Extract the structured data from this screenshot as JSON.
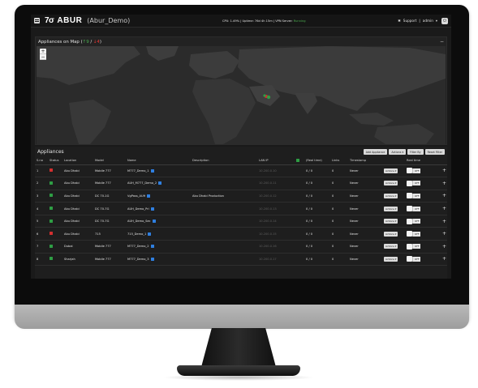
{
  "header": {
    "logo": "7σ",
    "brand": "ABUR",
    "project": "(Abur_Demo)",
    "cpu": "CPU: 1.49%",
    "uptime": "Uptime: 76d 4h 15m",
    "vpn_label": "VPN Server:",
    "vpn_status": "Running",
    "support": "Support",
    "user": "admin"
  },
  "map": {
    "title": "Appliances on Map (",
    "up_count": "9",
    "down_count": "4",
    "title_close": ")",
    "zoom_in": "+",
    "zoom_out": "−",
    "collapse": "−",
    "marker_colors": {
      "up": "#2e9e44",
      "down": "#d32f2f"
    }
  },
  "appliances": {
    "title": "Appliances",
    "buttons": [
      "Add Appliance",
      "Actions ▾",
      "Filter By",
      "Reset Filter"
    ],
    "columns": [
      "S.no",
      "Status",
      "Location",
      "Model",
      "Name",
      "Description",
      "LAN IP",
      "",
      "(Real time)",
      "Links",
      "Timestamp",
      "",
      "Real time",
      ""
    ],
    "rows": [
      {
        "sno": "1",
        "status": "down",
        "location": "Abu Dhabi",
        "model": "Mobile 777",
        "name": "M777_Demo_1",
        "description": "",
        "lan_ip": "10.200.0.10",
        "realtime": "0 / 0",
        "links": "0",
        "timestamp": "Never",
        "actions": "Actions ▾",
        "toggle": "OFF"
      },
      {
        "sno": "2",
        "status": "up",
        "location": "Abu Dhabi",
        "model": "Mobile 777",
        "name": "AUH_M777_Demo_2",
        "description": "",
        "lan_ip": "10.200.0.11",
        "realtime": "0 / 0",
        "links": "0",
        "timestamp": "Never",
        "actions": "Actions ▾",
        "toggle": "OFF"
      },
      {
        "sno": "3",
        "status": "up",
        "location": "Abu Dhabi",
        "model": "DC 70-1G",
        "name": "VgPass_AUH",
        "description": "Abu Dhabi Production",
        "lan_ip": "10.200.0.12",
        "realtime": "0 / 0",
        "links": "0",
        "timestamp": "Never",
        "actions": "Actions ▾",
        "toggle": "OFF"
      },
      {
        "sno": "4",
        "status": "up",
        "location": "Abu Dhabi",
        "model": "DC 70-7G",
        "name": "AUH_Demo_Pri",
        "description": "",
        "lan_ip": "10.200.0.13",
        "realtime": "0 / 0",
        "links": "0",
        "timestamp": "Never",
        "actions": "Actions ▾",
        "toggle": "OFF"
      },
      {
        "sno": "5",
        "status": "up",
        "location": "Abu Dhabi",
        "model": "DC 70-7G",
        "name": "AUH_Demo_Sec",
        "description": "",
        "lan_ip": "10.200.0.14",
        "realtime": "0 / 0",
        "links": "0",
        "timestamp": "Never",
        "actions": "Actions ▾",
        "toggle": "OFF"
      },
      {
        "sno": "6",
        "status": "down",
        "location": "Abu Dhabi",
        "model": "715",
        "name": "715_Demo_1",
        "description": "",
        "lan_ip": "10.200.0.15",
        "realtime": "0 / 0",
        "links": "0",
        "timestamp": "Never",
        "actions": "Actions ▾",
        "toggle": "OFF"
      },
      {
        "sno": "7",
        "status": "up",
        "location": "Dubai",
        "model": "Mobile 777",
        "name": "M777_Demo_2",
        "description": "",
        "lan_ip": "10.200.0.16",
        "realtime": "0 / 0",
        "links": "0",
        "timestamp": "Never",
        "actions": "Actions ▾",
        "toggle": "OFF"
      },
      {
        "sno": "8",
        "status": "up",
        "location": "Sharjah",
        "model": "Mobile 777",
        "name": "M777_Demo_3",
        "description": "",
        "lan_ip": "10.200.0.17",
        "realtime": "0 / 0",
        "links": "0",
        "timestamp": "Never",
        "actions": "Actions ▾",
        "toggle": "OFF"
      }
    ]
  }
}
